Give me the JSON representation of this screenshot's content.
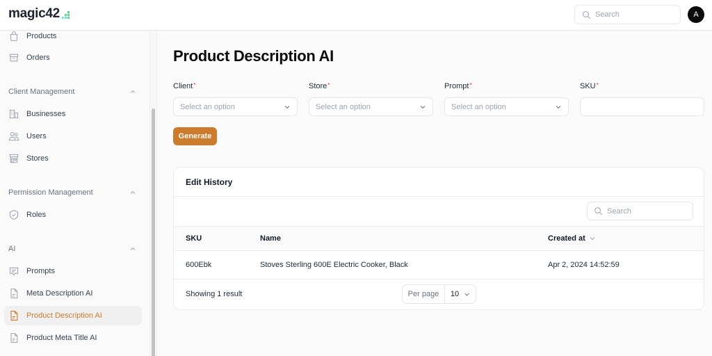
{
  "app": {
    "logo_text": "magic42",
    "logo_colors": [
      "#6ee7b7",
      "#4ade80",
      "#67e8f9"
    ],
    "accent": "#cc7a2b",
    "search_placeholder": "Search",
    "avatar_initial": "A"
  },
  "sidebar": {
    "top_items": [
      {
        "label": "Products",
        "icon": "shopping-bag-icon"
      },
      {
        "label": "Orders",
        "icon": "archive-box-icon"
      }
    ],
    "groups": [
      {
        "label": "Client Management",
        "items": [
          {
            "label": "Businesses",
            "icon": "building-icon"
          },
          {
            "label": "Users",
            "icon": "users-icon"
          },
          {
            "label": "Stores",
            "icon": "storefront-icon"
          }
        ]
      },
      {
        "label": "Permission Management",
        "items": [
          {
            "label": "Roles",
            "icon": "shield-check-icon"
          }
        ]
      },
      {
        "label": "AI",
        "items": [
          {
            "label": "Prompts",
            "icon": "chat-bubble-icon"
          },
          {
            "label": "Meta Description AI",
            "icon": "document-icon"
          },
          {
            "label": "Product Description AI",
            "icon": "document-icon",
            "active": true
          },
          {
            "label": "Product Meta Title AI",
            "icon": "document-icon"
          }
        ]
      }
    ]
  },
  "main": {
    "title": "Product Description AI",
    "form": {
      "fields": [
        {
          "label": "Client",
          "required": "*",
          "type": "select",
          "placeholder": "Select an option"
        },
        {
          "label": "Store",
          "required": "*",
          "type": "select",
          "placeholder": "Select an option"
        },
        {
          "label": "Prompt",
          "required": "*",
          "type": "select",
          "placeholder": "Select an option"
        },
        {
          "label": "SKU",
          "required": "*",
          "type": "text",
          "value": ""
        }
      ],
      "generate_label": "Generate"
    },
    "history": {
      "title": "Edit History",
      "search_placeholder": "Search",
      "columns": [
        "SKU",
        "Name",
        "Created at"
      ],
      "rows": [
        {
          "sku": "600Ebk",
          "name": "Stoves Sterling 600E Electric Cooker, Black",
          "created_at": "Apr 2, 2024 14:52:59"
        }
      ],
      "footer": {
        "summary": "Showing 1 result",
        "per_page_label": "Per page",
        "per_page_value": "10"
      }
    }
  }
}
